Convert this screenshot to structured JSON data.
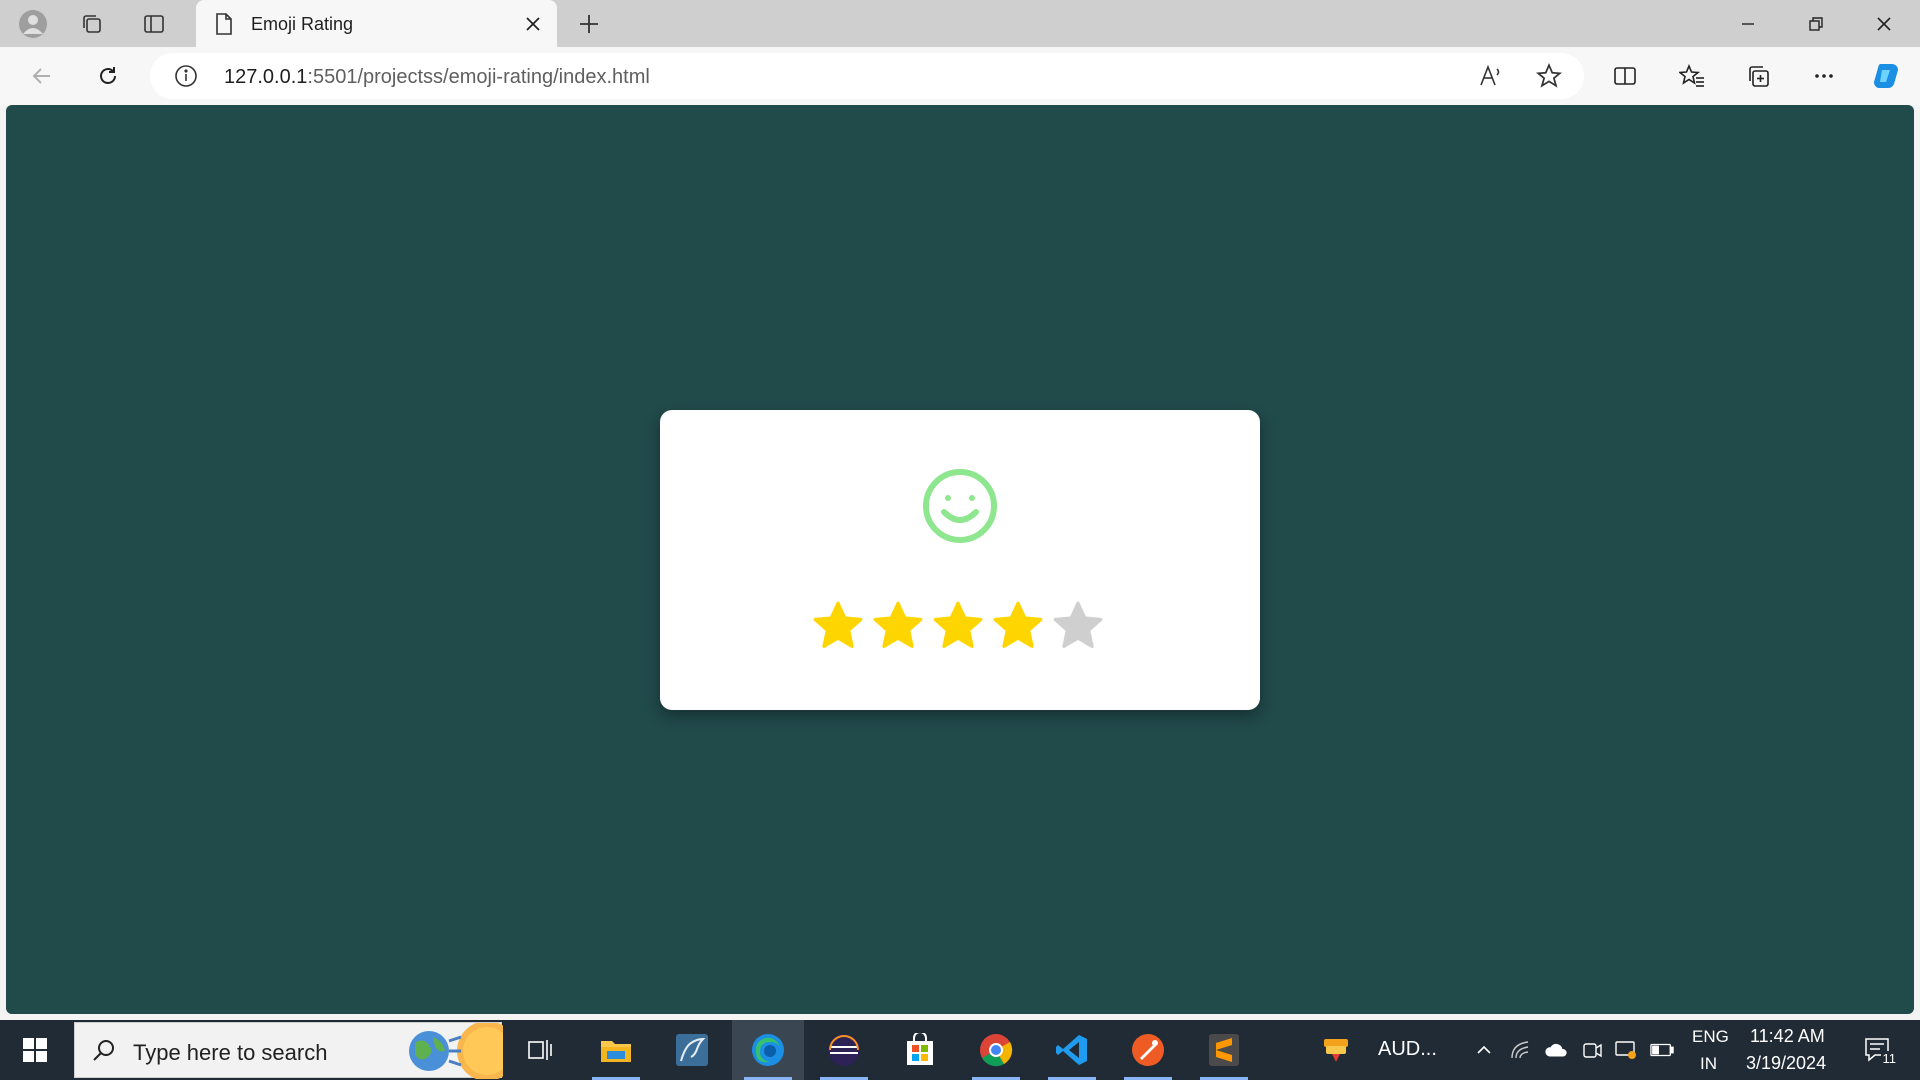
{
  "browser": {
    "tab_title": "Emoji Rating",
    "url_host": "127.0.0.1",
    "url_rest": ":5501/projectss/emoji-rating/index.html"
  },
  "page": {
    "background_color": "#214a4b",
    "emoji": {
      "icon": "smiley-face-icon",
      "color": "#8ee68e"
    },
    "rating": {
      "value": 4,
      "max": 5,
      "filled_color": "#ffd500",
      "empty_color": "#cfcfcf"
    }
  },
  "taskbar": {
    "search_placeholder": "Type here to search",
    "apps": [
      "task-view",
      "file-explorer",
      "mysql-workbench",
      "edge",
      "eclipse",
      "microsoft-store",
      "chrome",
      "vscode",
      "postman",
      "sublime-text"
    ],
    "tray_app_label": "AUD...",
    "language": "ENG",
    "region": "IN",
    "time": "11:42 AM",
    "date": "3/19/2024",
    "notification_count": "11"
  }
}
